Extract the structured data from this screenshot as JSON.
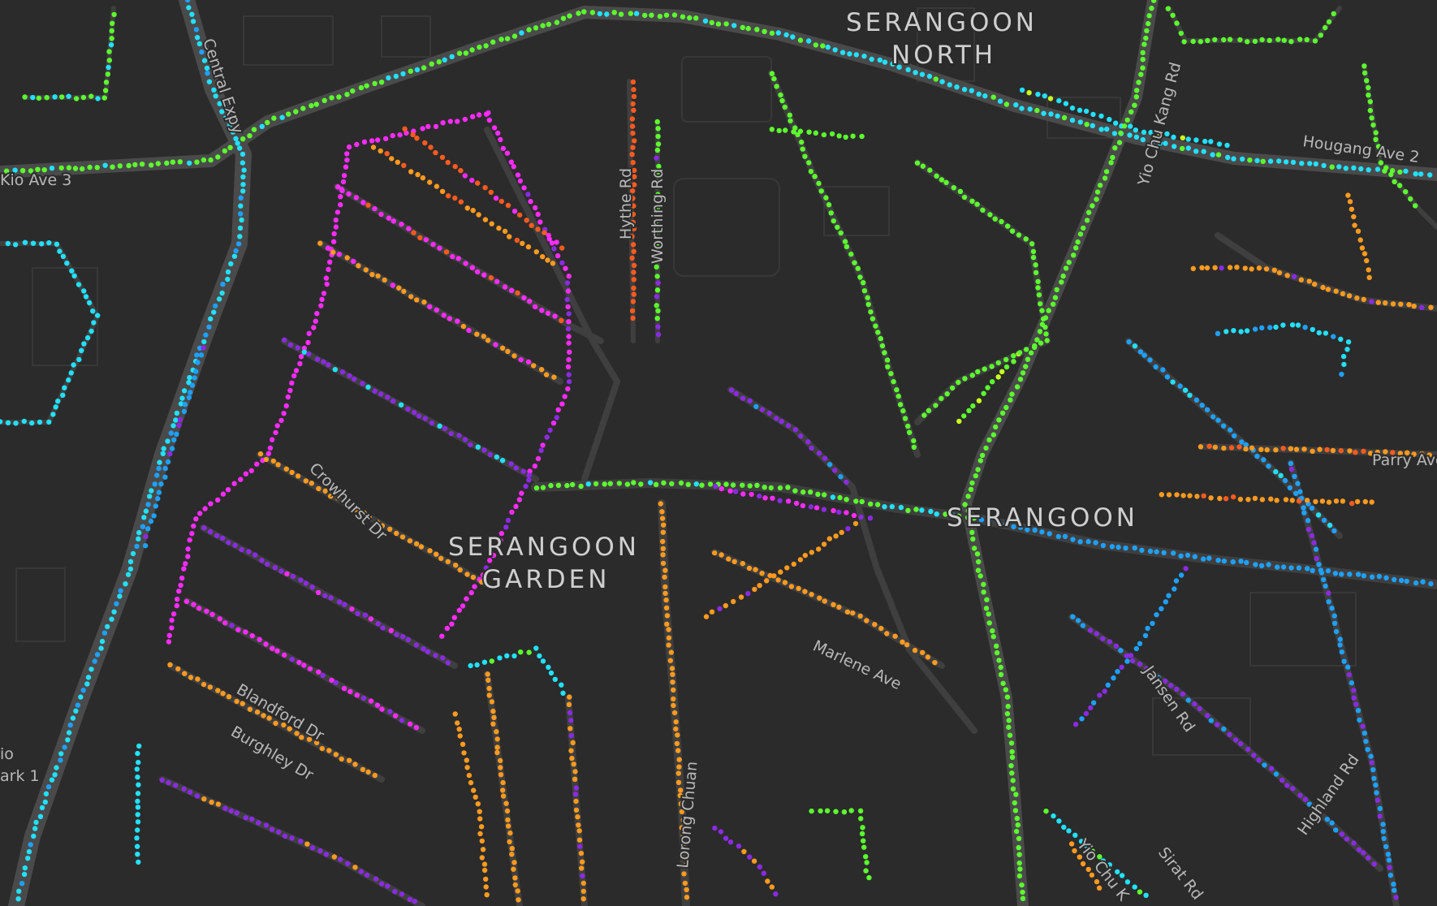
{
  "map": {
    "theme": "dark",
    "colors": {
      "background": "#2b2b2b",
      "road": "#3f3f3f",
      "major_road": "#4a4a4a",
      "label": "#cfcfcf"
    },
    "point_palette": [
      "#ff5a1f",
      "#ff9a1f",
      "#c8ff1f",
      "#5cff2e",
      "#22e0ff",
      "#1ea0ff",
      "#8a2be2",
      "#ff2bff"
    ],
    "area_labels": [
      {
        "line1": "SERANGOON",
        "line2": "NORTH"
      },
      {
        "line1": "SERANGOON",
        "line2": ""
      },
      {
        "line1": "SERANGOON",
        "line2": "GARDEN"
      }
    ],
    "street_labels": [
      "Central Expy",
      "Kio Ave 3",
      "Hythe Rd",
      "Worthing Rd",
      "Yio Chu Kang Rd",
      "Hougang Ave 2",
      "Parry Ave",
      "Crowhurst Dr",
      "Marlene Ave",
      "Jansen Rd",
      "Highland Rd",
      "Blandford Dr",
      "Burghley Dr",
      "Lorong Chuan",
      "Yio Chu K",
      "Sirat Rd",
      "io",
      "ark 1"
    ]
  }
}
